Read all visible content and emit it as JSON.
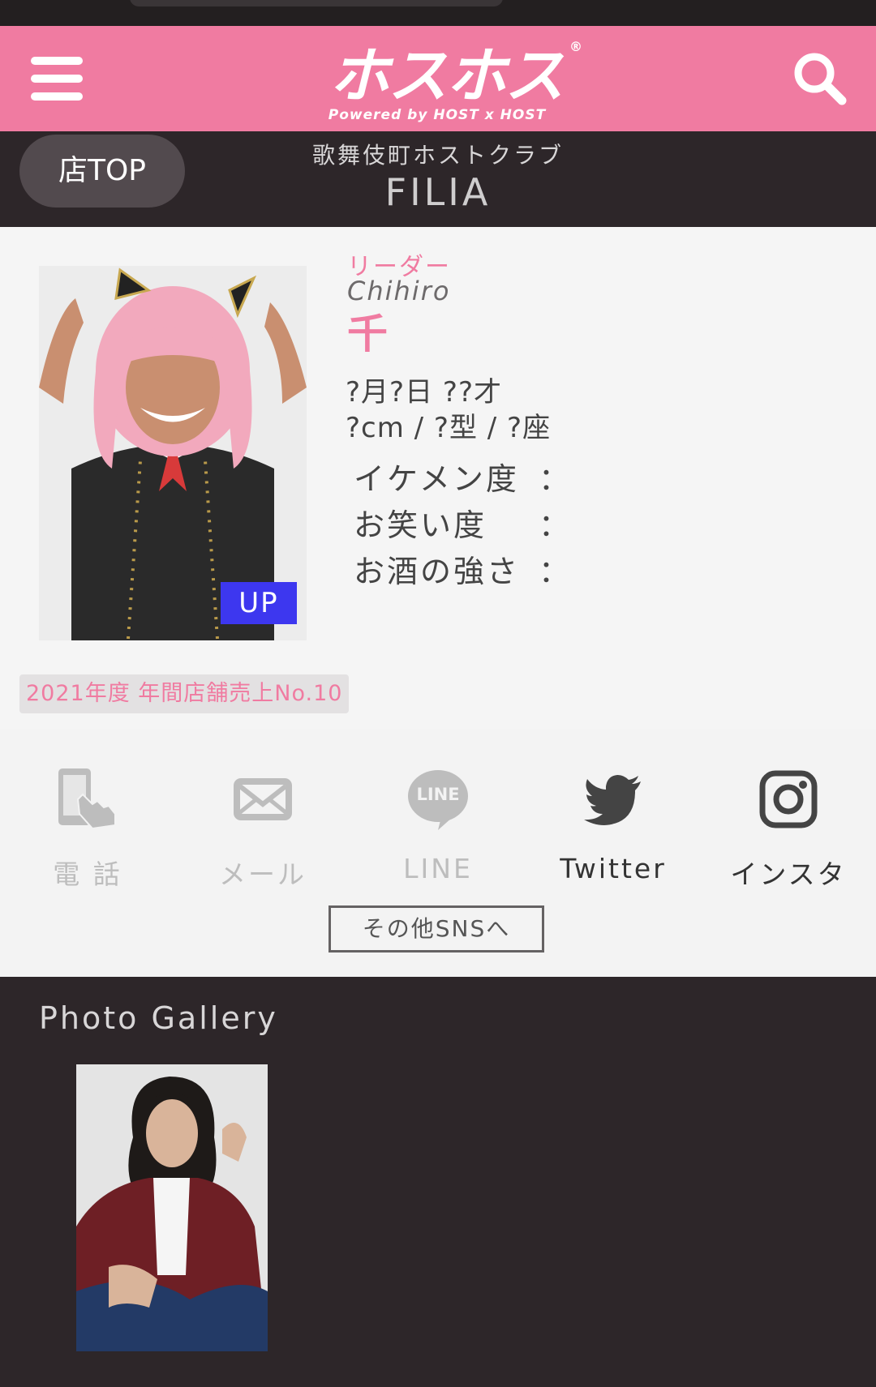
{
  "header": {
    "logo_text": "ホスホス",
    "logo_tagline": "Powered by HOST x HOST",
    "logo_mark": "®"
  },
  "shop": {
    "top_button": "店TOP",
    "category": "歌舞伎町ホストクラブ",
    "name": "FILIA"
  },
  "profile": {
    "role": "リーダー",
    "roman_name": "Chihiro",
    "name": "千",
    "birthday_age": "?月?日 ??才",
    "height_blood_sign": "?cm / ?型 / ?座",
    "badge": "UP",
    "stats": [
      {
        "label": "イケメン度",
        "sep": "："
      },
      {
        "label": "お笑い度",
        "sep": "："
      },
      {
        "label": "お酒の強さ",
        "sep": "："
      }
    ],
    "award": "2021年度 年間店舗売上No.10"
  },
  "contacts": [
    {
      "label": "電 話",
      "icon": "phone-touch-icon",
      "active": false
    },
    {
      "label": "メール",
      "icon": "mail-icon",
      "active": false
    },
    {
      "label": "LINE",
      "icon": "line-icon",
      "active": false,
      "icon_text": "LINE"
    },
    {
      "label": "Twitter",
      "icon": "twitter-icon",
      "active": true
    },
    {
      "label": "インスタ",
      "icon": "instagram-icon",
      "active": true
    }
  ],
  "other_sns_button": "その他SNSへ",
  "gallery": {
    "title": "Photo Gallery"
  },
  "colors": {
    "brand_pink": "#f07ba1",
    "dark_bg": "#2d2629",
    "up_badge": "#3d37ef",
    "inactive_icon": "#bdbdbd",
    "active_icon": "#444444"
  }
}
